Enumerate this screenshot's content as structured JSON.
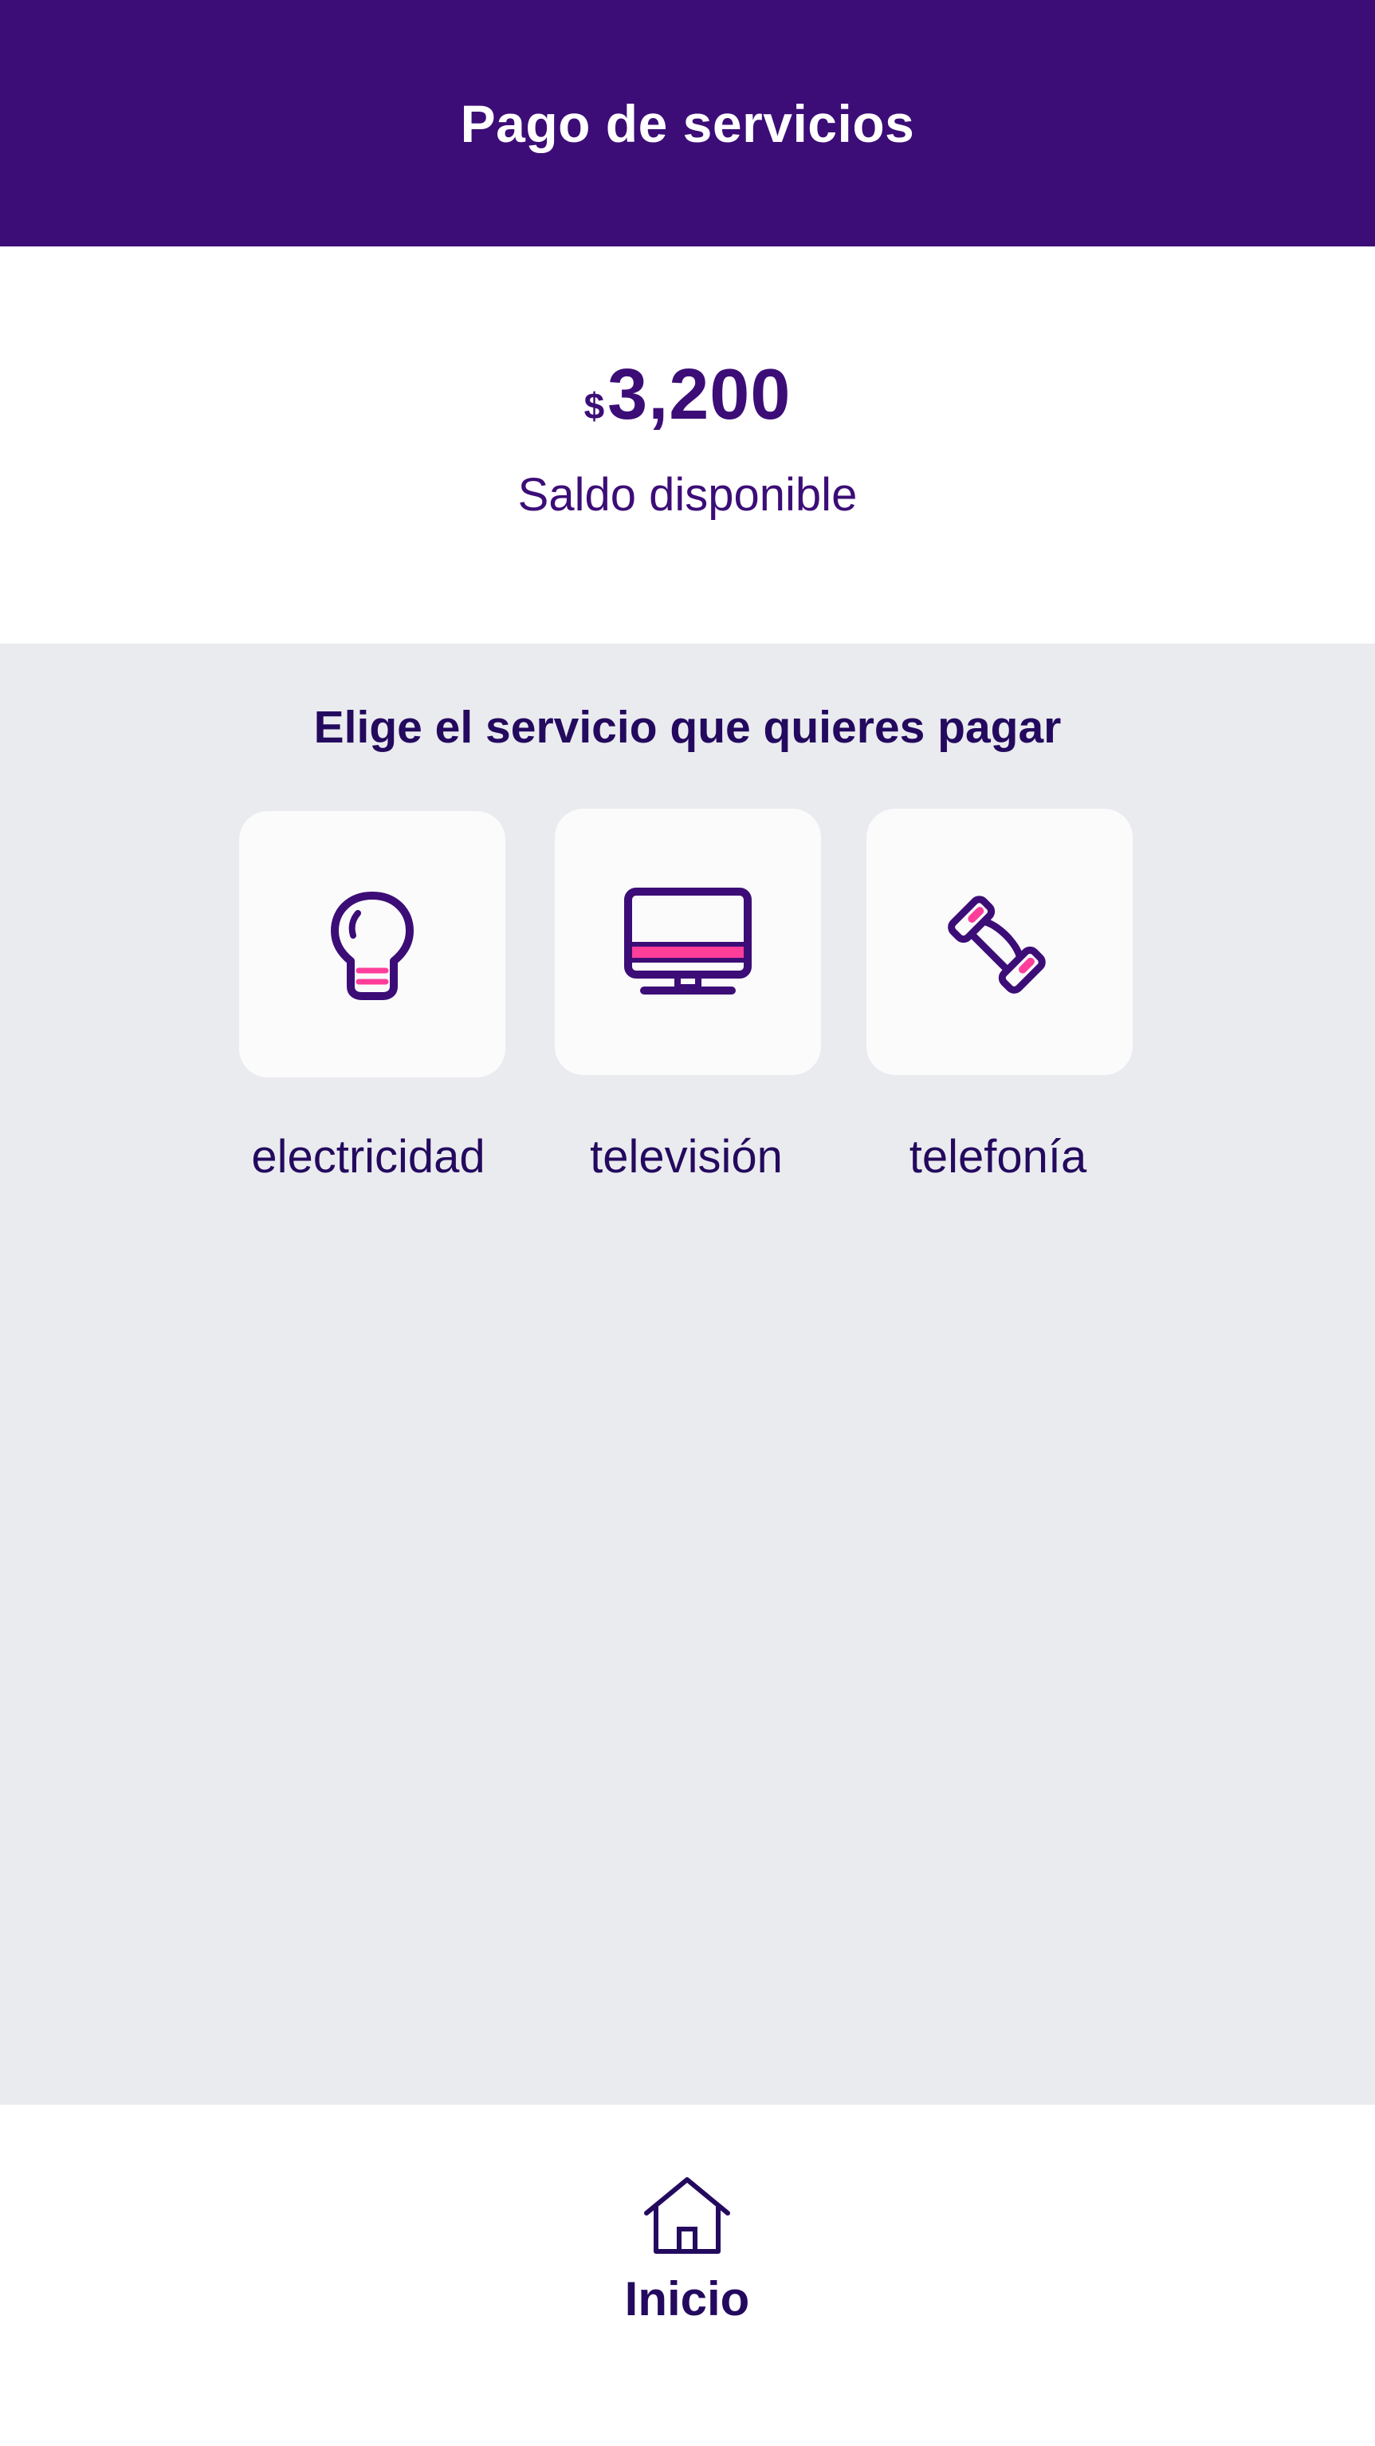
{
  "header": {
    "title": "Pago de servicios"
  },
  "balance": {
    "currency": "$",
    "amount": "3,200",
    "label": "Saldo disponible"
  },
  "services": {
    "heading": "Elige el servicio que quieres pagar",
    "items": [
      {
        "label": "electricidad",
        "icon": "lightbulb-icon"
      },
      {
        "label": "televisión",
        "icon": "monitor-icon"
      },
      {
        "label": "telefonía",
        "icon": "phone-icon"
      }
    ]
  },
  "bottom_nav": {
    "home_label": "Inicio",
    "home_icon": "home-icon"
  },
  "colors": {
    "primary": "#3c0d77",
    "accent": "#ff3e9a",
    "text_dark": "#240a5e",
    "background_gray": "#eaebef",
    "card_background": "#fbfbfc"
  }
}
